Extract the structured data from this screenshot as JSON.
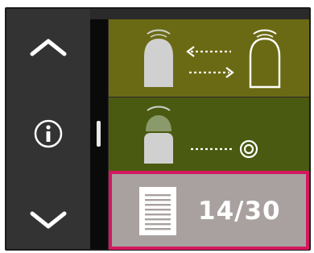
{
  "navigation": {
    "up_icon": "chevron-up-icon",
    "info_icon": "info-icon",
    "down_icon": "chevron-down-icon"
  },
  "panels": [
    {
      "name": "swap-tip-panel",
      "icon": "tip-swap-icon",
      "color": "#6b6a14"
    },
    {
      "name": "tip-to-target-panel",
      "icon": "tip-to-target-icon",
      "color": "#4a5a10"
    },
    {
      "name": "document-pages-panel",
      "icon": "document-icon",
      "color": "#a9a1a0",
      "selected": true
    }
  ],
  "document": {
    "page_counter": "14/30"
  },
  "colors": {
    "selection_border": "#d4185f",
    "frame": "#2a2a2a",
    "scroll_track": "#0a0a0a"
  }
}
